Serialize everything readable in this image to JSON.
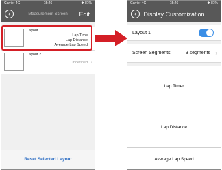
{
  "status_bar": {
    "carrier": "Carrier",
    "network": "4G",
    "time": "15:26",
    "battery": "81%"
  },
  "left_screen": {
    "title": "Measurement Screen",
    "edit_label": "Edit",
    "layouts": [
      {
        "name": "Layout 1",
        "items": [
          "Lap Time",
          "Lap Distance",
          "Average Lap Speed"
        ]
      },
      {
        "name": "Layout 2",
        "status": "Undefined"
      }
    ],
    "reset_label": "Reset Selected Layout"
  },
  "right_screen": {
    "title": "Display Customization",
    "layout_name": "Layout 1",
    "layout_enabled": true,
    "segments_label": "Screen Segments",
    "segments_value": "3 segments",
    "segments": [
      "Lap Timer",
      "Lap Distance",
      "Average Lap Speed"
    ]
  },
  "colors": {
    "nav_bar": "#585858",
    "highlight": "#d41f26",
    "accent": "#3a8ee6",
    "link": "#2f6fc4"
  }
}
